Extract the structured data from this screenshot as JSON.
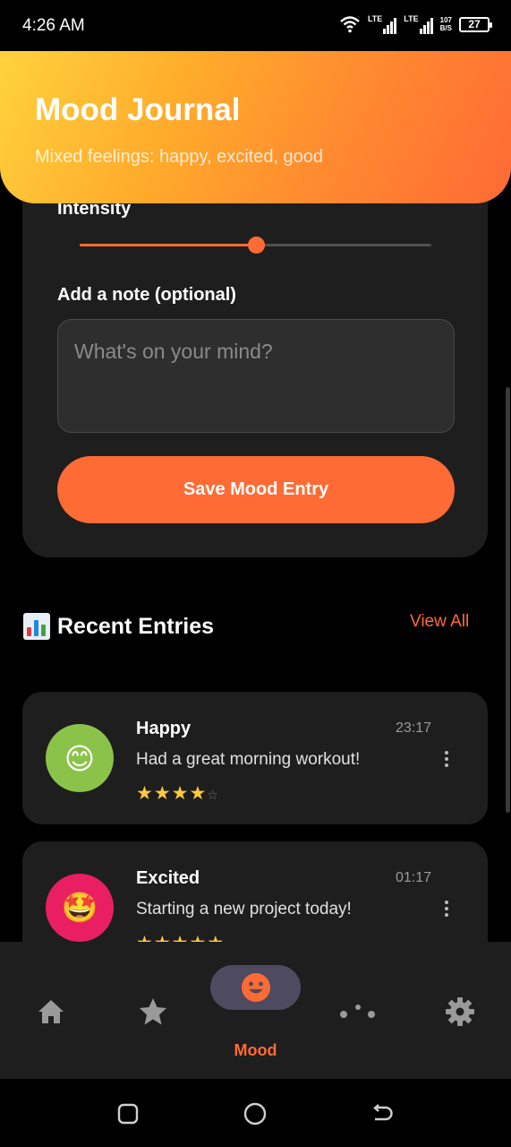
{
  "status_bar": {
    "time": "4:26 AM",
    "signal_1": "LTE",
    "signal_2": "LTE",
    "net_speed_value": "107",
    "net_speed_unit": "B/S",
    "battery": "27",
    "icons": [
      "wifi-icon",
      "signal-icon",
      "signal-icon",
      "battery-icon"
    ]
  },
  "header": {
    "title": "Mood Journal",
    "subtitle": "Mixed feelings: happy, excited, good"
  },
  "form": {
    "intensity_label": "Intensity",
    "intensity_fraction": 0.5,
    "note_label": "Add a note (optional)",
    "note_placeholder": "What's on your mind?",
    "note_value": "",
    "save_label": "Save Mood Entry"
  },
  "recent": {
    "title": "Recent Entries",
    "title_icon": "bar-chart-emoji-icon",
    "view_all": "View All",
    "entries": [
      {
        "mood": "Happy",
        "emoji": "😊",
        "color": "#8bc34a",
        "time": "23:17",
        "note": "Had a great morning workout!",
        "rating": 4,
        "max_rating": 5
      },
      {
        "mood": "Excited",
        "emoji": "🤩",
        "color": "#e91e63",
        "time": "01:17",
        "note": "Starting a new project today!",
        "rating": 5,
        "max_rating": 5
      }
    ]
  },
  "bottom_nav": {
    "items": [
      {
        "icon": "home-icon",
        "active": false
      },
      {
        "icon": "star-icon",
        "active": false
      },
      {
        "icon": "mood-face-icon",
        "active": true,
        "label": "Mood"
      },
      {
        "icon": "dots-icon",
        "active": false
      },
      {
        "icon": "gear-icon",
        "active": false
      }
    ],
    "active_label": "Mood"
  },
  "colors": {
    "accent": "#ff6b35",
    "background": "#000000",
    "card": "#1e1e1e",
    "star": "#ffc93c"
  }
}
